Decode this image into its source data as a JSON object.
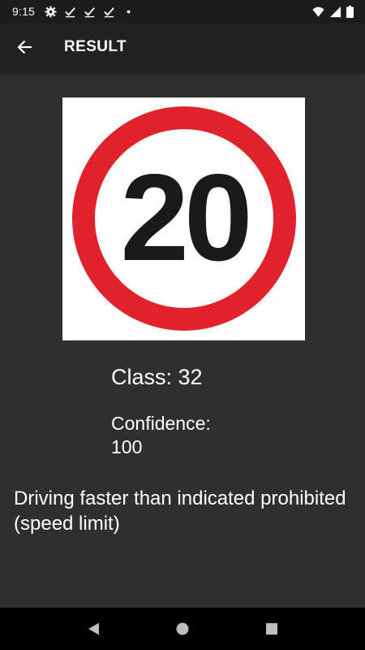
{
  "status_bar": {
    "time": "9:15",
    "icons_left": [
      "gear-icon",
      "check-icon",
      "check-icon",
      "check-icon",
      "dot-icon"
    ],
    "icons_right": [
      "wifi-icon",
      "signal-icon",
      "battery-icon"
    ]
  },
  "app_bar": {
    "back_icon": "arrow-left-icon",
    "title": "RESULT"
  },
  "result": {
    "sign_number": "20",
    "class_text": "Class: 32",
    "confidence_label": "Confidence:",
    "confidence_value": "100",
    "description": "Driving faster than indicated prohibited (speed limit)"
  },
  "nav_bar": {
    "buttons": [
      "back-triangle-icon",
      "home-circle-icon",
      "recents-square-icon"
    ]
  },
  "colors": {
    "background": "#2f2f2f",
    "app_bar": "#212121",
    "status_bar": "#1c1c1c",
    "nav_bar": "#000000",
    "sign_red": "#e0222c",
    "sign_black": "#1a1a1a"
  }
}
